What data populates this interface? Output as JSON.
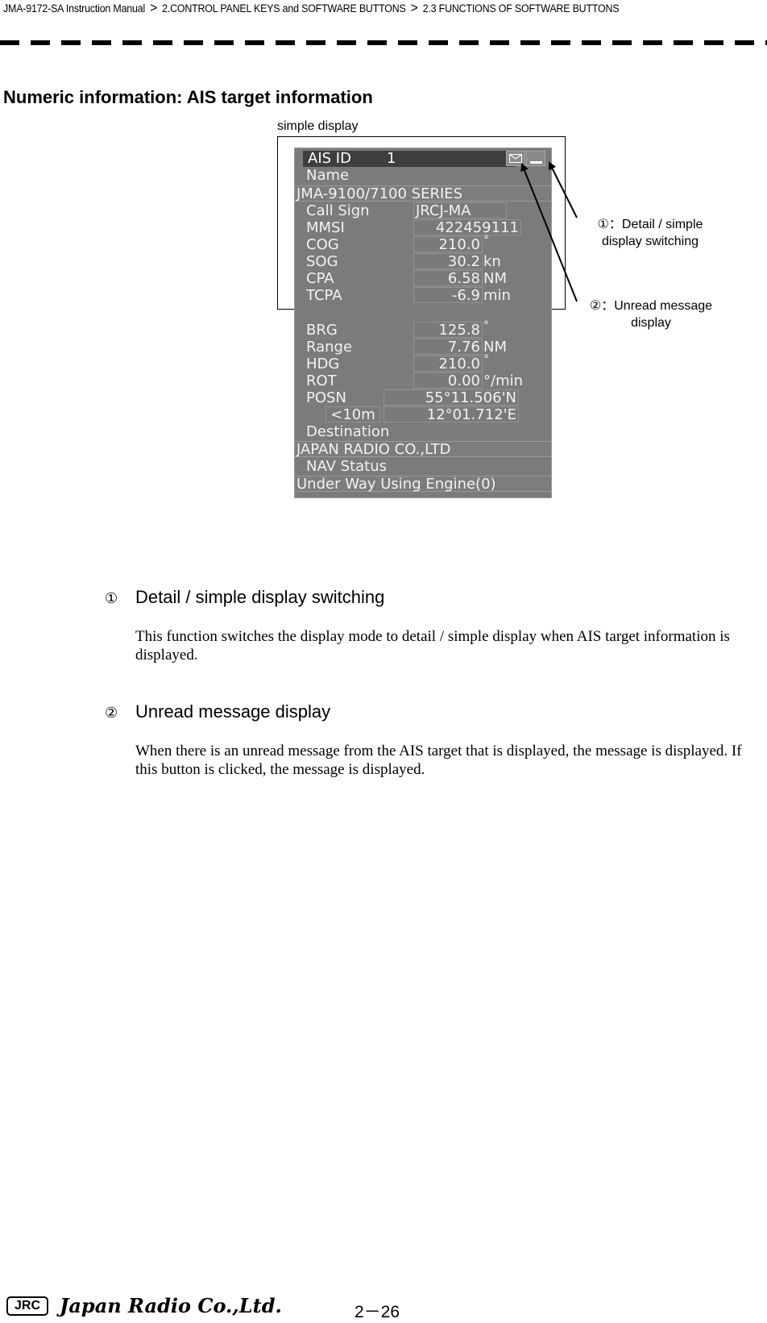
{
  "breadcrumb": {
    "items": [
      "JMA-9172-SA Instruction Manual",
      "2.CONTROL PANEL KEYS and SOFTWARE BUTTONS",
      "2.3  FUNCTIONS OF SOFTWARE BUTTONS"
    ],
    "separator": ">"
  },
  "section_title": "Numeric information: AIS target information",
  "figure": {
    "caption": "simple display",
    "panel": {
      "header_label": "AIS  ID",
      "header_id": "1",
      "msg_icon": "envelope-icon",
      "min_icon": "minimize-icon",
      "name_label": "Name",
      "name_value": "JMA-9100/7100  SERIES",
      "rows": [
        {
          "label": "Call  Sign",
          "value": "JRCJ-MA",
          "unit": ""
        },
        {
          "label": "MMSI",
          "value": "422459111",
          "unit": ""
        },
        {
          "label": "COG",
          "value": "210.0",
          "unit": "°"
        },
        {
          "label": "SOG",
          "value": "30.2",
          "unit": "kn"
        },
        {
          "label": "CPA",
          "value": "6.58",
          "unit": "NM"
        },
        {
          "label": "TCPA",
          "value": "-6.9",
          "unit": "min"
        },
        {
          "label": "BRG",
          "value": "125.8",
          "unit": "°"
        },
        {
          "label": "Range",
          "value": "7.76",
          "unit": "NM"
        },
        {
          "label": "HDG",
          "value": "210.0",
          "unit": "°"
        },
        {
          "label": "ROT",
          "value": "0.00",
          "unit": "°/min"
        }
      ],
      "posn_label": "POSN",
      "posn_lat": "55°11.506'N",
      "posn_lon": "12°01.712'E",
      "posn_accuracy": "<10m",
      "destination_label": "Destination",
      "destination_value": "JAPAN  RADIO  CO.,LTD",
      "nav_status_label": "NAV  Status",
      "nav_status_value": "Under  Way  Using  Engine(0)"
    },
    "callouts": [
      {
        "line1": "①：Detail / simple",
        "line2": "display switching"
      },
      {
        "line1": "②：Unread message",
        "line2": "display"
      }
    ]
  },
  "items": [
    {
      "number": "①",
      "title": "Detail / simple display switching",
      "body": "This function switches the display mode to detail / simple display when AIS target information is displayed."
    },
    {
      "number": "②",
      "title": "Unread message display",
      "body": "When there is an unread message from the AIS target that is displayed, the message is displayed. If this button is clicked, the message is displayed."
    }
  ],
  "footer": {
    "logo": "JRC",
    "company": "Japan Radio Co.,Ltd.",
    "page": "2－26"
  }
}
